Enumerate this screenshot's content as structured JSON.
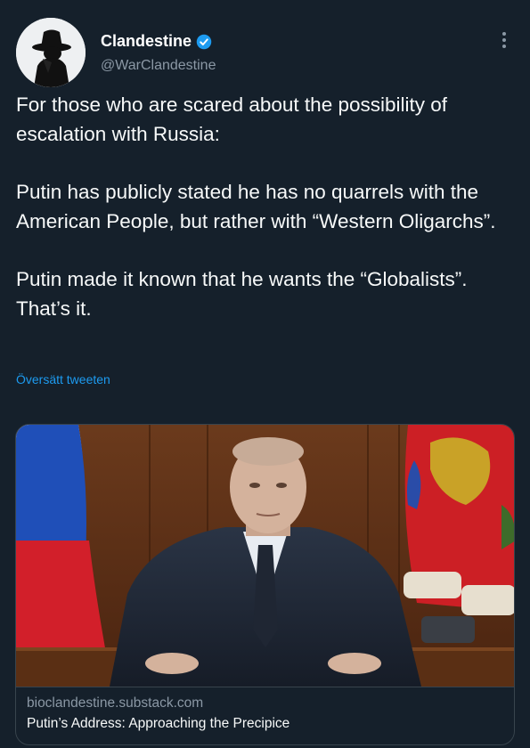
{
  "tweet": {
    "author": {
      "display_name": "Clandestine",
      "handle": "@WarClandestine",
      "verified": true,
      "avatar_icon": "spy-silhouette-icon"
    },
    "paragraphs": [
      "For those who are scared about the possibility of escalation with Russia:",
      "Putin has publicly stated he has no quarrels with the American People, but rather with “Western Oligarchs”.",
      "Putin made it known that he wants the “Globalists”. That’s it."
    ],
    "translate_label": "Översätt tweeten",
    "more_icon": "more-vertical-icon"
  },
  "link_card": {
    "domain": "bioclandestine.substack.com",
    "title": "Putin’s Address: Approaching the Precipice",
    "image_icon": "card-photo"
  },
  "colors": {
    "background": "#15202b",
    "text": "#f7f9f9",
    "secondary": "#8b98a5",
    "link": "#1d9bf0",
    "border": "#38444d"
  }
}
